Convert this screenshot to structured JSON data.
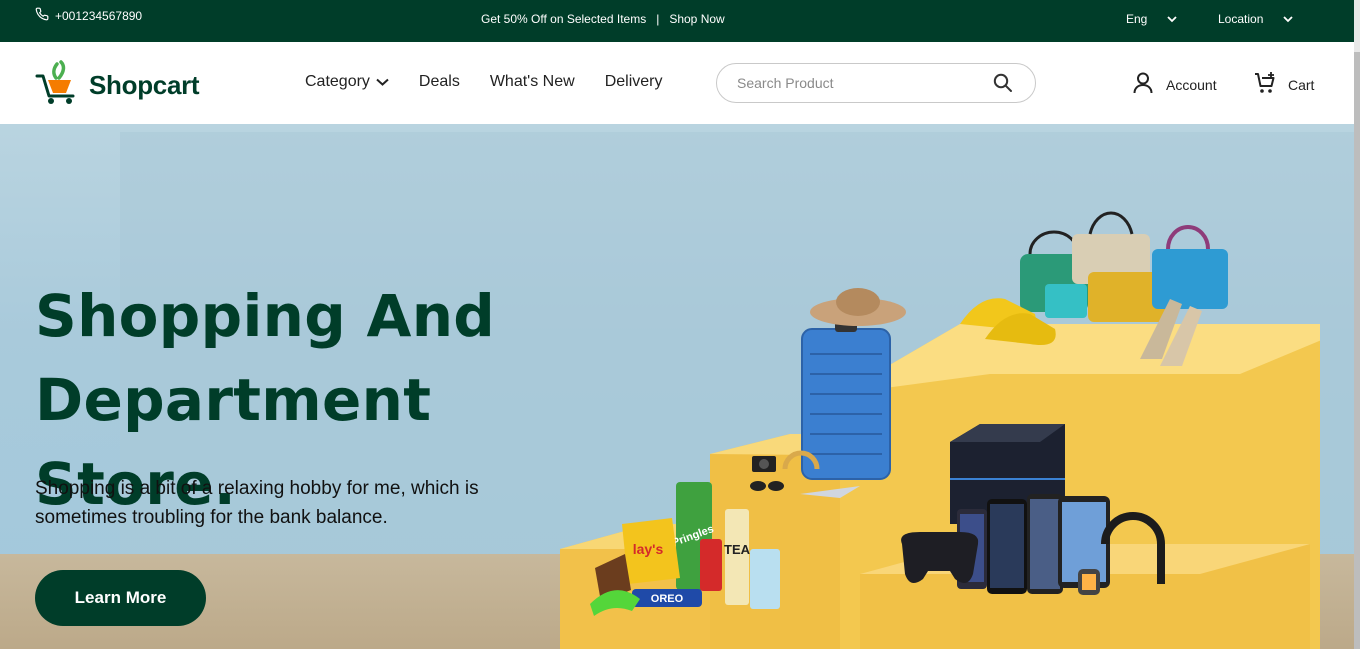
{
  "topbar": {
    "phone": "+001234567890",
    "promo_text": "Get 50% Off on Selected Items",
    "divider": "|",
    "promo_link": "Shop Now",
    "language": "Eng",
    "location": "Location"
  },
  "header": {
    "logo_text": "Shopcart",
    "nav": [
      "Category",
      "Deals",
      "What's New",
      "Delivery"
    ],
    "search_placeholder": "Search Product",
    "account_label": "Account",
    "cart_label": "Cart"
  },
  "hero": {
    "title_line1": "Shopping And",
    "title_line2": "Department Store.",
    "subtitle": "Shopping is a bit of a relaxing hobby for me, which is sometimes troubling for the bank balance.",
    "cta_label": "Learn More",
    "product_labels": {
      "chips_brand": "lay's",
      "can_brand": "Pringles",
      "tea_label": "TEA",
      "cookie_brand": "OREO"
    }
  },
  "colors": {
    "brand_dark_green": "#003d29",
    "logo_orange": "#f57c00",
    "logo_leaf_green": "#4caf50",
    "hero_sky": "#a9cadb",
    "podium_yellow": "#f5c94b"
  },
  "icons": {
    "phone": "phone-icon",
    "chevron": "chevron-down-icon",
    "logo": "shopping-cart-logo-icon",
    "search": "search-icon",
    "account": "user-icon",
    "cart": "cart-icon"
  }
}
